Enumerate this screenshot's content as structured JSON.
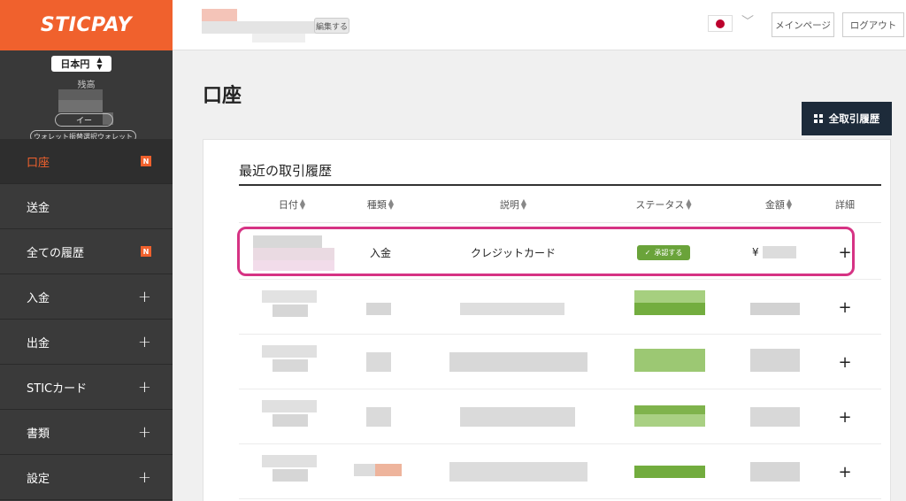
{
  "sidebar": {
    "logo": "STICPAY",
    "currency": "日本円",
    "balance_label": "残高",
    "id_pill": "イー",
    "wallet_pill": "ウォレット振替選択ウォレット",
    "items": [
      {
        "label": "口座",
        "badge": "N"
      },
      {
        "label": "送金"
      },
      {
        "label": "全ての履歴",
        "badge": "N"
      },
      {
        "label": "入金"
      },
      {
        "label": "出金"
      },
      {
        "label": "STICカード"
      },
      {
        "label": "書類"
      },
      {
        "label": "設定"
      }
    ]
  },
  "header": {
    "edit_button": "編集する",
    "main_page": "メインページ",
    "logout": "ログアウト"
  },
  "main": {
    "title": "口座",
    "all_history_button": "全取引履歴",
    "card_title": "最近の取引履歴",
    "columns": [
      "日付",
      "種類",
      "説明",
      "ステータス",
      "金額",
      "詳細"
    ],
    "first_row": {
      "type": "入金",
      "description": "クレジットカード",
      "status": "承認する",
      "amount_prefix": "¥"
    }
  },
  "colors": {
    "brand": "#f0612d",
    "sidebar_bg": "#3a3a3a",
    "status_green": "#6aa33a",
    "highlight": "#d63384",
    "dark_button": "#1d2b3a"
  }
}
